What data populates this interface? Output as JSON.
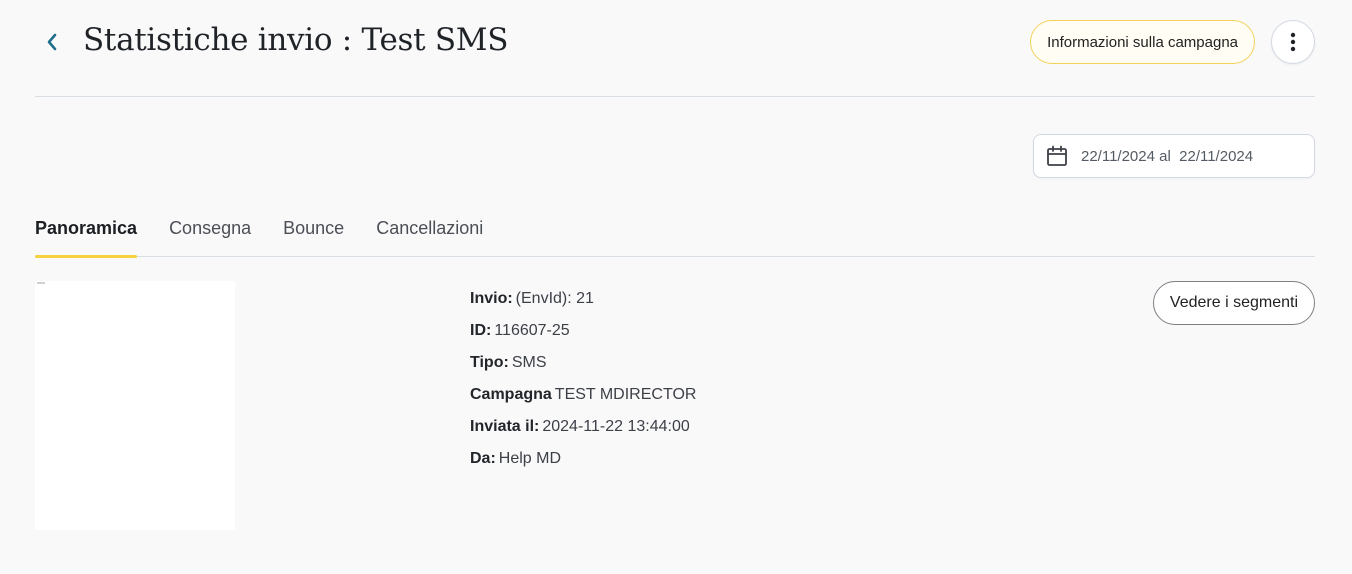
{
  "header": {
    "title": "Statistiche invio : Test SMS",
    "campaign_info_label": "Informazioni sulla campagna"
  },
  "date_range": {
    "text": "22/11/2024 al  22/11/2024"
  },
  "tabs": [
    {
      "label": "Panoramica",
      "active": true
    },
    {
      "label": "Consegna",
      "active": false
    },
    {
      "label": "Bounce",
      "active": false
    },
    {
      "label": "Cancellazioni",
      "active": false
    }
  ],
  "details": [
    {
      "label": "Invio:",
      "value": "(EnvId): 21"
    },
    {
      "label": "ID:",
      "value": "116607-25"
    },
    {
      "label": "Tipo:",
      "value": "SMS"
    },
    {
      "label": "Campagna",
      "value": "TEST MDIRECTOR"
    },
    {
      "label": "Inviata il:",
      "value": "2024-11-22 13:44:00"
    },
    {
      "label": "Da:",
      "value": "Help MD"
    }
  ],
  "segments_button_label": "Vedere i segmenti",
  "icons": {
    "back": "chevron-left-icon",
    "more": "more-vertical-icon",
    "calendar": "calendar-icon"
  },
  "colors": {
    "accent": "#f5d23e",
    "back_arrow": "#1f6e8c",
    "background": "#f9f9fa"
  }
}
